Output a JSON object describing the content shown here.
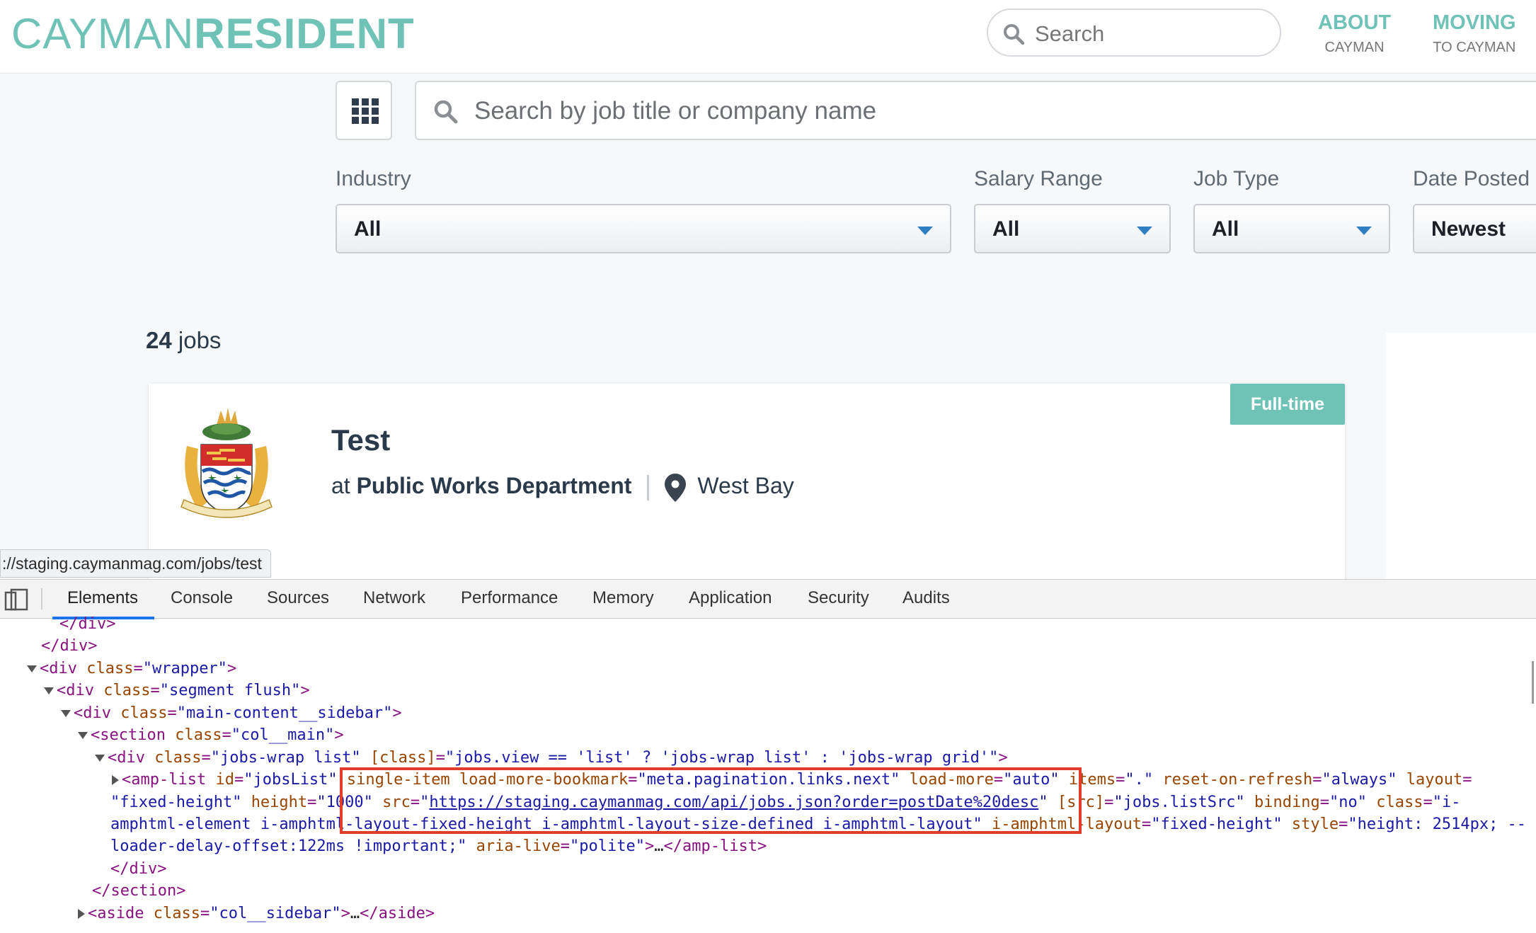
{
  "header": {
    "logo_thin": "CAYMAN",
    "logo_bold": "RESIDENT",
    "search_placeholder": "Search",
    "nav": [
      {
        "label": "ABOUT",
        "sub": "CAYMAN"
      },
      {
        "label": "MOVING",
        "sub": "TO CAYMAN"
      }
    ]
  },
  "jobs": {
    "search_placeholder": "Search by job title or company name",
    "filters": [
      {
        "label": "Industry",
        "value": "All"
      },
      {
        "label": "Salary Range",
        "value": "All"
      },
      {
        "label": "Job Type",
        "value": "All"
      },
      {
        "label": "Date Posted",
        "value": "Newest"
      }
    ],
    "count_number": "24",
    "count_suffix": "jobs",
    "card": {
      "badge": "Full-time",
      "title": "Test",
      "at": "at",
      "company": "Public Works Department",
      "location": "West Bay"
    }
  },
  "status_url": "://staging.caymanmag.com/jobs/test",
  "devtools": {
    "tabs": [
      "Elements",
      "Console",
      "Sources",
      "Network",
      "Performance",
      "Memory",
      "Application",
      "Security",
      "Audits"
    ],
    "active_tab": "Elements",
    "code": {
      "l1_close_div": "</div>",
      "l2_close_div": "</div>",
      "wrapper_attr": "class",
      "wrapper_val": "\"wrapper\"",
      "segment_val": "\"segment flush\"",
      "sidebar_val": "\"main-content__sidebar\"",
      "section_val": "\"col__main\"",
      "jobswrap_val": "\"jobs-wrap list\"",
      "jobswrap_battr": "[class]",
      "jobswrap_bval": "\"jobs.view == 'list' ? 'jobs-wrap list' : 'jobs-wrap grid'\"",
      "amp_id": "\"jobsList\"",
      "amp_single": "single-item",
      "amp_bookmark_val": "\"meta.pagination.links.next\"",
      "amp_loadmore_val": "\"auto\"",
      "amp_items_val": "\".\"",
      "amp_reset_val": "\"always\"",
      "amp_layout_val": "\"fixed-height\"",
      "amp_height_val": "\"1000\"",
      "amp_src": "https://staging.caymanmag.com/api/jobs.json?order=postDate%20desc",
      "amp_bsrc_val": "\"jobs.listSrc\"",
      "amp_binding_val": "\"no\"",
      "amp_class_val_1": "\"i-",
      "amp_class_val_2": "amphtml-element i-amphtml-layout-fixed-height i-amphtml-layout-size-defined i-amphtml-layout\"",
      "amp_ilayout_val": "\"fixed-height\"",
      "amp_style_val_1": "\"height: 2514px; --",
      "amp_style_val_2": "loader-delay-offset:122ms !important;\"",
      "amp_aria_val": "\"polite\"",
      "aside_val": "\"col__sidebar\""
    }
  }
}
